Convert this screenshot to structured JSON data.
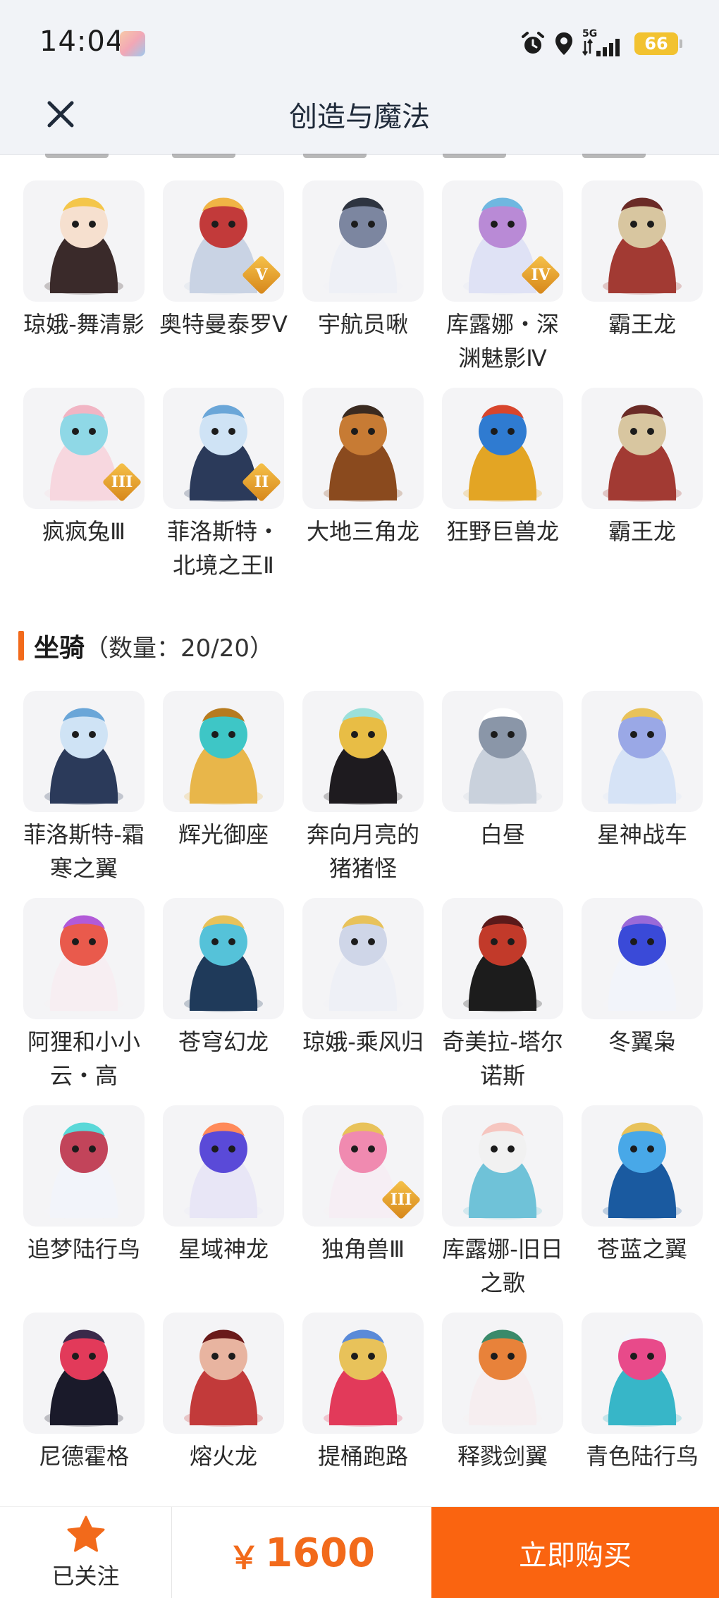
{
  "status_bar": {
    "time": "14:04",
    "network": "5G",
    "battery": "66",
    "icons": [
      "avatar-sticker-icon",
      "alarm-icon",
      "location-icon",
      "signal-icon",
      "battery-icon"
    ]
  },
  "header": {
    "title": "创造与魔法",
    "close_icon": "close-icon"
  },
  "pets": {
    "items": [
      {
        "label": "琼娥-舞清影",
        "icon": "chang-e-dancer"
      },
      {
        "label": "奥特曼泰罗Ⅴ",
        "icon": "ultraman-taro",
        "badge": "V"
      },
      {
        "label": "宇航员啾",
        "icon": "astronaut-chick"
      },
      {
        "label": "库露娜・深渊魅影Ⅳ",
        "icon": "kuluna-abyss",
        "badge": "IV"
      },
      {
        "label": "霸王龙",
        "icon": "tyrannosaurus"
      },
      {
        "label": "疯疯兔Ⅲ",
        "icon": "crazy-rabbit",
        "badge": "III"
      },
      {
        "label": "菲洛斯特・北境之王Ⅱ",
        "icon": "frost-king",
        "badge": "II"
      },
      {
        "label": "大地三角龙",
        "icon": "triceratops"
      },
      {
        "label": "狂野巨兽龙",
        "icon": "wild-beast-dragon"
      },
      {
        "label": "霸王龙",
        "icon": "tyrannosaurus"
      }
    ]
  },
  "mounts": {
    "title": "坐骑",
    "count_text": "（数量：20/20）",
    "items": [
      {
        "label": "菲洛斯特-霜寒之翼",
        "icon": "frost-wing"
      },
      {
        "label": "辉光御座",
        "icon": "radiant-throne"
      },
      {
        "label": "奔向月亮的猪猪怪",
        "icon": "moon-pig"
      },
      {
        "label": "白昼",
        "icon": "white-day-dragon"
      },
      {
        "label": "星神战车",
        "icon": "star-chariot"
      },
      {
        "label": "阿狸和小小云・高",
        "icon": "ali-cloud"
      },
      {
        "label": "苍穹幻龙",
        "icon": "sky-dragon"
      },
      {
        "label": "琼娥-乘风归",
        "icon": "chang-e-wind"
      },
      {
        "label": "奇美拉-塔尔诺斯",
        "icon": "chimera"
      },
      {
        "label": "冬翼枭",
        "icon": "winter-owl"
      },
      {
        "label": "追梦陆行鸟",
        "icon": "dream-chocobo"
      },
      {
        "label": "星域神龙",
        "icon": "star-dragon"
      },
      {
        "label": "独角兽Ⅲ",
        "icon": "unicorn",
        "badge": "III"
      },
      {
        "label": "库露娜-旧日之歌",
        "icon": "kuluna-song"
      },
      {
        "label": "苍蓝之翼",
        "icon": "azure-wing"
      },
      {
        "label": "尼德霍格",
        "icon": "nidhogg"
      },
      {
        "label": "熔火龙",
        "icon": "lava-dragon"
      },
      {
        "label": "提桶跑路",
        "icon": "bucket-run"
      },
      {
        "label": "释戮剑翼",
        "icon": "sword-wing"
      },
      {
        "label": "青色陆行鸟",
        "icon": "cyan-chocobo"
      }
    ]
  },
  "bottom_bar": {
    "follow_label": "已关注",
    "currency": "￥",
    "price": "1600",
    "buy_label": "立即购买",
    "accent": "#fa6410"
  }
}
